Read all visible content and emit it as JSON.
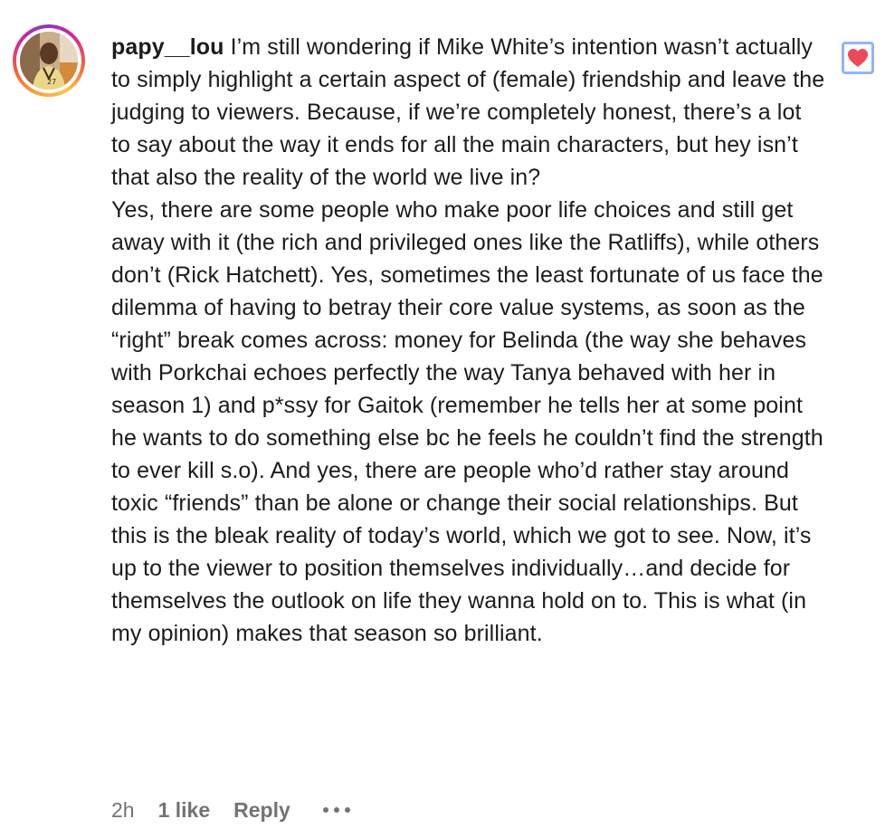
{
  "comment": {
    "username": "papy__lou",
    "text_first": "I’m still wondering if Mike White’s intention wasn’t actually to simply highlight a certain aspect of (female) friendship and leave the judging to viewers. Because, if we’re completely honest, there’s a lot to say about the way it ends for all the main characters, but hey isn’t that also the reality of the world we live in?",
    "text_second": "Yes, there are some people who make poor life choices and still get away with it (the rich and privileged ones like the Ratliffs), while others don’t (Rick Hatchett). Yes, sometimes the least fortunate of us face the dilemma of having to betray their core value systems, as soon as the “right” break comes across: money for Belinda (the way she behaves with Porkchai echoes perfectly the way Tanya behaved with her in season 1) and p*ssy for Gaitok (remember he tells her at some point he wants to do something else bc he feels he couldn’t find the strength to ever kill s.o). And yes, there are people who’d rather stay around toxic “friends” than be alone or change their social relationships. But this is the bleak reality of today’s world, which we got to see. Now, it’s up to the viewer to position themselves individually…and decide for themselves the outlook on life they wanna hold on to. This is what (in my opinion) makes that season so brilliant.",
    "time": "2h",
    "likes": "1 like",
    "reply_label": "Reply",
    "more_icon": "more-horizontal-icon",
    "like_icon": "heart-filled-icon",
    "liked": true
  },
  "colors": {
    "text": "#1c1c1c",
    "meta": "#737373",
    "heart": "#ed4956",
    "like_box_border": "#8fb6f5"
  }
}
